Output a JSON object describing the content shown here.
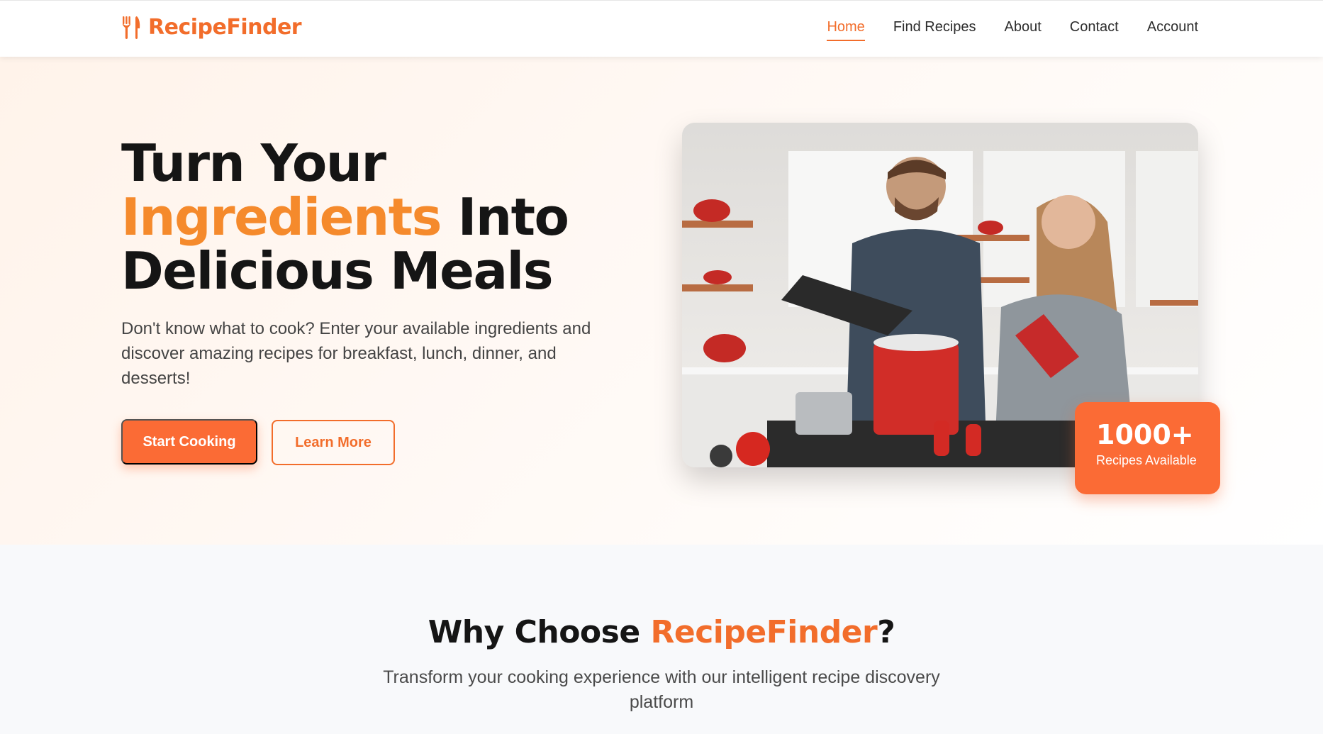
{
  "brand": {
    "name": "RecipeFinder",
    "icon": "fork-knife-icon",
    "color": "#f26d2b"
  },
  "nav": {
    "items": [
      {
        "label": "Home",
        "active": true
      },
      {
        "label": "Find Recipes",
        "active": false
      },
      {
        "label": "About",
        "active": false
      },
      {
        "label": "Contact",
        "active": false
      },
      {
        "label": "Account",
        "active": false
      }
    ]
  },
  "hero": {
    "title_line1": "Turn Your",
    "title_accent": "Ingredients",
    "title_line2_rest": " Into",
    "title_line3": "Delicious Meals",
    "description": "Don't know what to cook? Enter your available ingredients and discover amazing recipes for breakfast, lunch, dinner, and desserts!",
    "primary_button": "Start Cooking",
    "secondary_button": "Learn More",
    "stat_number": "1000+",
    "stat_label": "Recipes Available"
  },
  "why": {
    "title_prefix": "Why Choose ",
    "title_accent": "RecipeFinder",
    "title_suffix": "?",
    "subtitle": "Transform your cooking experience with our intelligent recipe discovery platform"
  },
  "colors": {
    "accent": "#fb6b35",
    "accent_text": "#f26d2b",
    "heading": "#151515"
  }
}
